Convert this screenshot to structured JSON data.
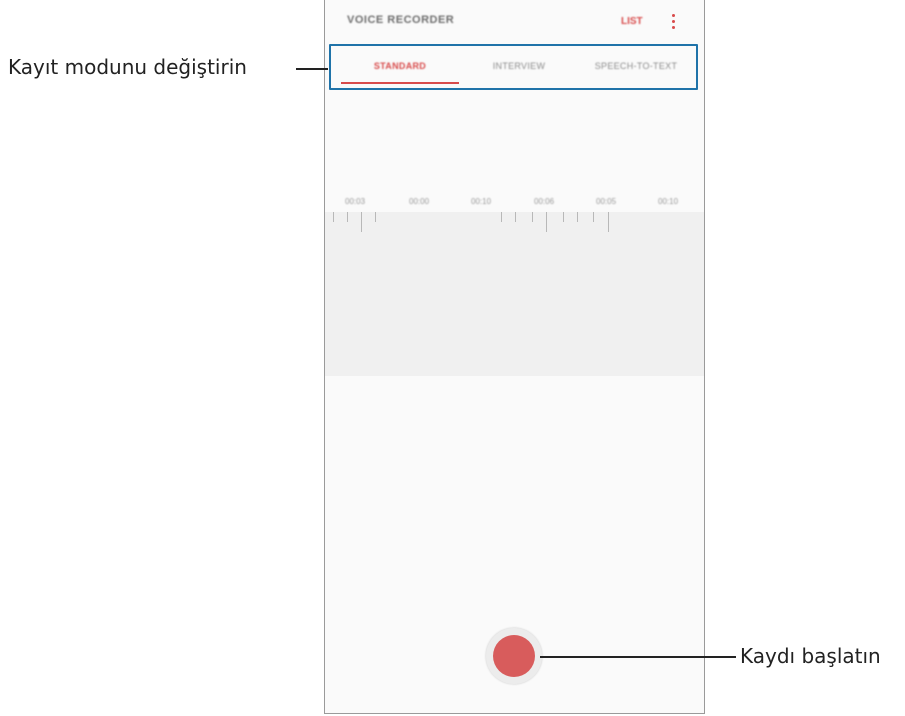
{
  "app": {
    "title": "VOICE RECORDER",
    "list_label": "LIST",
    "more_icon": "more-vertical-icon"
  },
  "tabs": [
    {
      "label": "STANDARD",
      "active": true
    },
    {
      "label": "INTERVIEW",
      "active": false
    },
    {
      "label": "SPEECH-TO-TEXT",
      "active": false
    }
  ],
  "timeline": {
    "labels": [
      "00:03",
      "00:00",
      "00:10",
      "00:06",
      "00:05",
      "00:10"
    ]
  },
  "record_button": {
    "icon": "record-icon",
    "color": "#d85c5c"
  },
  "annotations": {
    "mode_label": "Kayıt modunu değiştirin",
    "record_label": "Kaydı başlatın"
  },
  "colors": {
    "accent": "#d84b4b",
    "highlight_box": "#1f73a9"
  }
}
